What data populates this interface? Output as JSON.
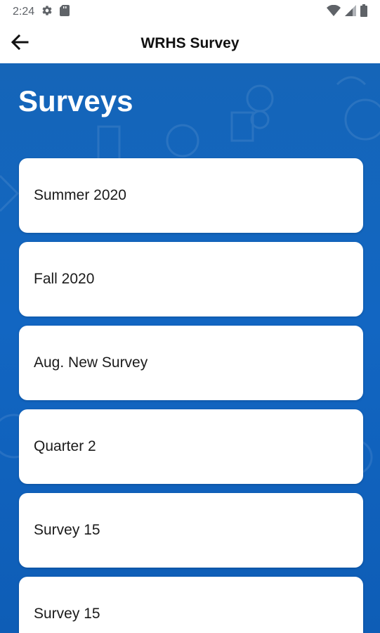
{
  "status_bar": {
    "time": "2:24",
    "icons": [
      "settings-icon",
      "sd-card-icon",
      "wifi-icon",
      "cell-signal-icon",
      "battery-icon"
    ]
  },
  "app_bar": {
    "title": "WRHS Survey",
    "back_icon": "arrow-left-icon"
  },
  "main": {
    "heading": "Surveys",
    "background_color": "#1266c2",
    "surveys": [
      {
        "label": "Summer 2020"
      },
      {
        "label": "Fall 2020"
      },
      {
        "label": "Aug. New Survey"
      },
      {
        "label": "Quarter 2"
      },
      {
        "label": "Survey 15"
      },
      {
        "label": "Survey 15"
      }
    ]
  }
}
